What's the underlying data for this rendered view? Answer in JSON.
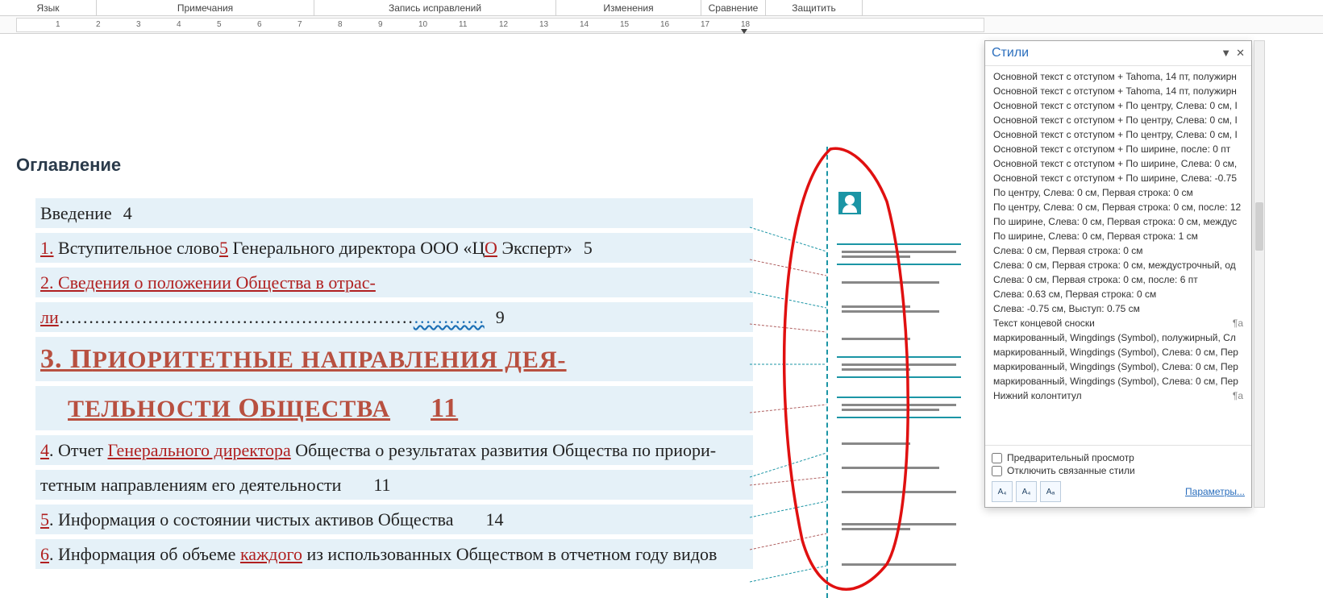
{
  "tabs": {
    "t1": "Язык",
    "t2": "Примечания",
    "t3": "Запись исправлений",
    "t4": "Изменения",
    "t5": "Сравнение",
    "t6": "Защитить"
  },
  "ruler_numbers": [
    "1",
    "2",
    "3",
    "4",
    "5",
    "6",
    "7",
    "8",
    "9",
    "10",
    "11",
    "12",
    "13",
    "14",
    "15",
    "16",
    "17",
    "18"
  ],
  "doc": {
    "heading": "Оглавление",
    "toc": {
      "r1_text": "Введение",
      "r1_page": "4",
      "r2_num": "1.",
      "r2_a": " Вступительное слово",
      "r2_b": "5",
      "r2_c": " Генерального директора ООО «Ц",
      "r2_o": "О",
      "r2_d": " Эксперт»",
      "r2_page": "5",
      "r3_full": "2. Сведения о положении Общества в отрас-",
      "r4_a": "ли",
      "r4_dots": "……………………………………………………",
      "r4_dots2": "…………",
      "r4_page": "9",
      "r5a": "3.",
      "r5b": " П",
      "r5c": "РИОРИТЕТНЫЕ НАПРАВЛЕНИЯ ДЕЯ-",
      "r6a": "ТЕЛЬНОСТИ ",
      "r6b": "О",
      "r6c": "БЩЕСТВА",
      "r6_page": "11",
      "r7_num": "4",
      "r7_a": ". Отчет ",
      "r7_b": "Генерального директора",
      "r7_c": " Общества о результатах развития Общества по приори-",
      "r8": "тетным направлениям его деятельности",
      "r8_page": "11",
      "r9_num": "5",
      "r9_a": ". Информация о состоянии чистых активов Общества",
      "r9_page": "14",
      "r10_num": "6",
      "r10_a": ". Информация об объеме ",
      "r10_b": "каждого",
      "r10_c": " из использованных Обществом в отчетном году видов"
    }
  },
  "styles": {
    "title": "Стили",
    "items": [
      "Основной текст с отступом + Tahoma, 14 пт, полужирн",
      "Основной текст с отступом + Tahoma, 14 пт, полужирн",
      "Основной текст с отступом + По центру, Слева:  0 см, I",
      "Основной текст с отступом + По центру, Слева:  0 см, I",
      "Основной текст с отступом + По центру, Слева:  0 см, I",
      "Основной текст с отступом + По ширине, после: 0 пт",
      "Основной текст с отступом + По ширине, Слева:  0 см,",
      "Основной текст с отступом + По ширине, Слева:  -0.75",
      "По центру, Слева:  0 см, Первая строка:  0 см",
      "По центру, Слева:  0 см, Первая строка:  0 см, после: 12",
      "По ширине, Слева:  0 см, Первая строка:  0 см, междус",
      "По ширине, Слева:  0 см, Первая строка:  1 см",
      "Слева:  0 см, Первая строка:  0 см",
      "Слева:  0 см, Первая строка:  0 см, междустрочный,  од",
      "Слева:  0 см, Первая строка:  0 см, после: 6 пт",
      "Слева:  0.63 см, Первая строка:  0 см",
      "Слева:  -0.75 см, Выступ:  0.75 см",
      "Текст концевой сноски",
      "маркированный, Wingdings (Symbol), полужирный, Сл",
      "маркированный, Wingdings (Symbol), Слева:  0 см, Пер",
      "маркированный, Wingdings (Symbol), Слева:  0 см, Пер",
      "маркированный, Wingdings (Symbol), Слева:  0 см, Пер",
      "Нижний колонтитул"
    ],
    "para_symbol": "¶a",
    "chk_preview": "Предварительный просмотр",
    "chk_linked": "Отключить связанные стили",
    "btn1": "A₄",
    "btn2": "A₄",
    "btn3": "Aₐ",
    "params": "Параметры..."
  }
}
